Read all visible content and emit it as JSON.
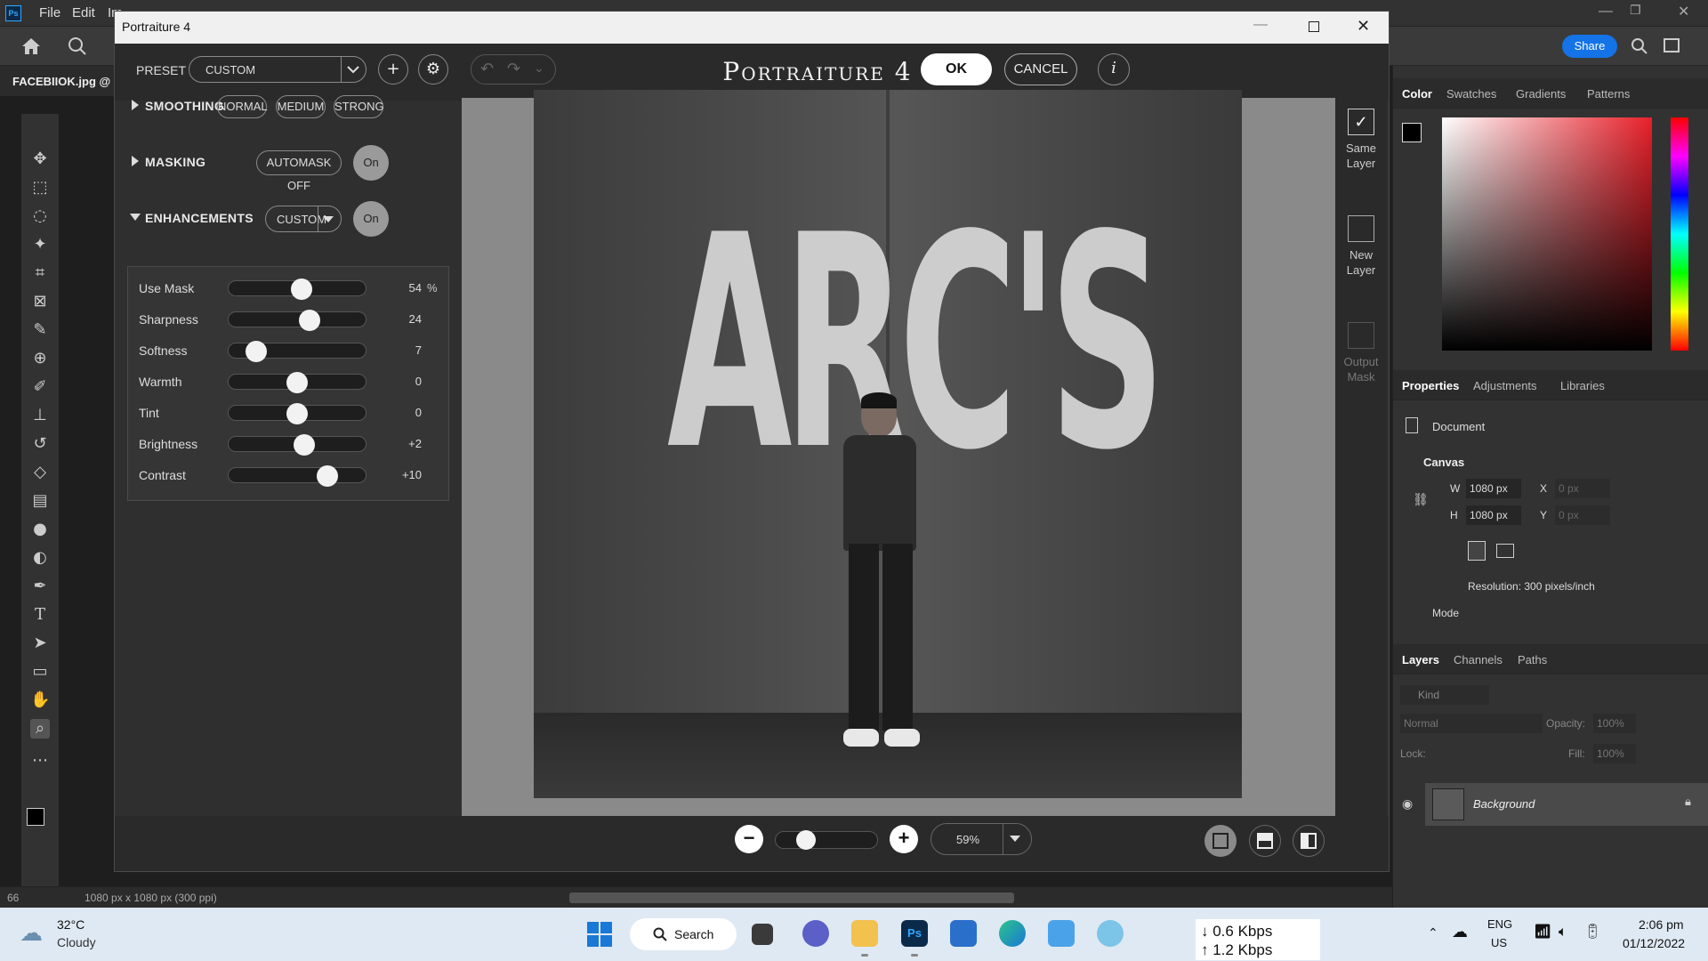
{
  "ps": {
    "menu": [
      "File",
      "Edit",
      "Im"
    ],
    "doc_tab": "FACEBIIOK.jpg @",
    "share_label": "Share",
    "status_zoom": "66",
    "status_info": "1080 px x 1080 px (300 ppi)",
    "right_tabs1": [
      "Color",
      "Swatches",
      "Gradients",
      "Patterns"
    ],
    "right_tabs2": [
      "Properties",
      "Adjustments",
      "Libraries"
    ],
    "right_tabs3": [
      "Layers",
      "Channels",
      "Paths"
    ],
    "properties": {
      "document_label": "Document",
      "canvas_label": "Canvas",
      "w_label": "W",
      "w_value": "1080 px",
      "h_label": "H",
      "h_value": "1080 px",
      "x_label": "X",
      "x_value": "0 px",
      "y_label": "Y",
      "y_value": "0 px",
      "resolution": "Resolution: 300 pixels/inch",
      "mode_label": "Mode"
    },
    "layers": {
      "kind_placeholder": "Kind",
      "blend_mode": "Normal",
      "opacity_label": "Opacity:",
      "opacity_value": "100%",
      "lock_label": "Lock:",
      "fill_label": "Fill:",
      "fill_value": "100%",
      "layer_name": "Background"
    },
    "colors": {
      "accent": "#1473e6"
    }
  },
  "dialog": {
    "window_title": "Portraiture 4",
    "app_title": "Portraiture 4",
    "preset_label": "PRESET",
    "preset_value": "CUSTOM",
    "ok_label": "OK",
    "cancel_label": "CANCEL",
    "info_label": "i",
    "smoothing": {
      "label": "SMOOTHING",
      "options": [
        "NORMAL",
        "MEDIUM",
        "STRONG"
      ]
    },
    "masking": {
      "label": "MASKING",
      "automask": "AUTOMASK OFF",
      "toggle": "On"
    },
    "enhancements": {
      "label": "ENHANCEMENTS",
      "preset": "CUSTOM",
      "toggle": "On"
    },
    "sliders": [
      {
        "label": "Use Mask",
        "value": "54",
        "unit": "%",
        "pos": 0.53
      },
      {
        "label": "Sharpness",
        "value": "24",
        "unit": "",
        "pos": 0.59
      },
      {
        "label": "Softness",
        "value": "7",
        "unit": "",
        "pos": 0.2
      },
      {
        "label": "Warmth",
        "value": "0",
        "unit": "",
        "pos": 0.5
      },
      {
        "label": "Tint",
        "value": "0",
        "unit": "",
        "pos": 0.5
      },
      {
        "label": "Brightness",
        "value": "+2",
        "unit": "",
        "pos": 0.55
      },
      {
        "label": "Contrast",
        "value": "+10",
        "unit": "",
        "pos": 0.72
      }
    ],
    "side": {
      "same_layer": [
        "Same",
        "Layer"
      ],
      "new_layer": [
        "New",
        "Layer"
      ],
      "output_mask": [
        "Output",
        "Mask"
      ]
    },
    "photo_text": "ARC'S",
    "zoom_value": "59%",
    "zoom_slider_pos": 0.3
  },
  "taskbar": {
    "weather_temp": "32°C",
    "weather_desc": "Cloudy",
    "search_label": "Search",
    "net_down": "↓ 0.6 Kbps",
    "net_up": "↑ 1.2 Kbps",
    "lang1": "ENG",
    "lang2": "US",
    "time": "2:06 pm",
    "date": "01/12/2022"
  }
}
